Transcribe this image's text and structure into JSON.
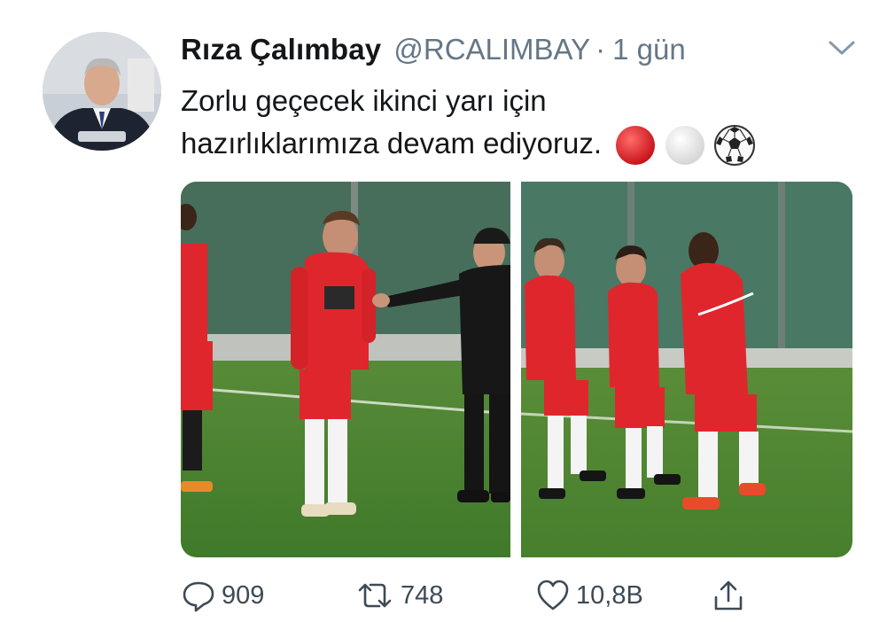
{
  "tweet": {
    "author_name": "Rıza Çalımbay",
    "handle": "@RCALIMBAY",
    "separator": "·",
    "time": "1 gün",
    "text_line1": "Zorlu geçecek ikinci yarı için",
    "text_line2": "hazırlıklarımıza devam ediyoruz.",
    "emojis": [
      "red-circle",
      "white-circle",
      "soccer-ball"
    ]
  },
  "actions": {
    "reply_count": "909",
    "retweet_count": "748",
    "like_count": "10,8B"
  },
  "colors": {
    "text": "#14171a",
    "secondary": "#657786",
    "jersey_red": "#e0262d",
    "pitch_green": "#4f8a35"
  }
}
